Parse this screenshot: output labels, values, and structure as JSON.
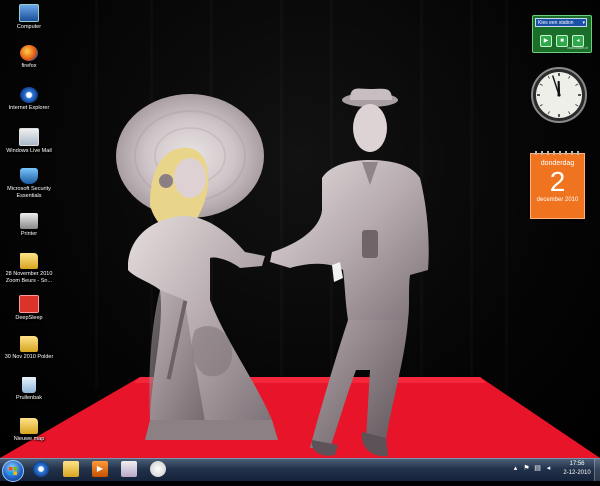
{
  "desktop_icons": [
    {
      "label": "Computer",
      "icon": "computer-icon"
    },
    {
      "label": "firefox",
      "icon": "firefox-icon"
    },
    {
      "label": "Internet Explorer",
      "icon": "internet-explorer-icon"
    },
    {
      "label": "Windows Live Mail",
      "icon": "mail-icon"
    },
    {
      "label": "Microsoft Security Essentials",
      "icon": "security-essentials-icon"
    },
    {
      "label": "Printer",
      "icon": "printer-icon"
    },
    {
      "label": "28 November 2010 Zoom Beurs - Sn...",
      "icon": "folder-icon"
    },
    {
      "label": "DeepSleep",
      "icon": "deepsleep-icon"
    },
    {
      "label": "30 Nov 2010 Polder",
      "icon": "folder-icon"
    },
    {
      "label": "Prullenbak",
      "icon": "recycle-bin-icon"
    },
    {
      "label": "Nieuwe map",
      "icon": "folder-icon"
    }
  ],
  "radio_gadget": {
    "station_placeholder": "Kies een station",
    "brand": "radiowatch.nl",
    "buttons": [
      "play-icon",
      "stop-icon",
      "volume-icon"
    ]
  },
  "clock_gadget": {
    "hour": 11,
    "minute": 57
  },
  "calendar_gadget": {
    "day_name": "donderdag",
    "day": "2",
    "month_year": "december 2010"
  },
  "taskbar": {
    "pinned": [
      "internet-explorer-icon",
      "explorer-folder-icon",
      "media-player-icon",
      "paint-icon",
      "snipping-icon"
    ],
    "tray_icons": [
      "show-hidden-icons-icon",
      "action-center-flag-icon",
      "network-icon",
      "volume-icon"
    ],
    "time": "17:56",
    "date": "2-12-2010"
  },
  "colors": {
    "stage_red": "#e8142a",
    "calendar_orange": "#f0741f",
    "radio_green": "#1b6d2a"
  }
}
